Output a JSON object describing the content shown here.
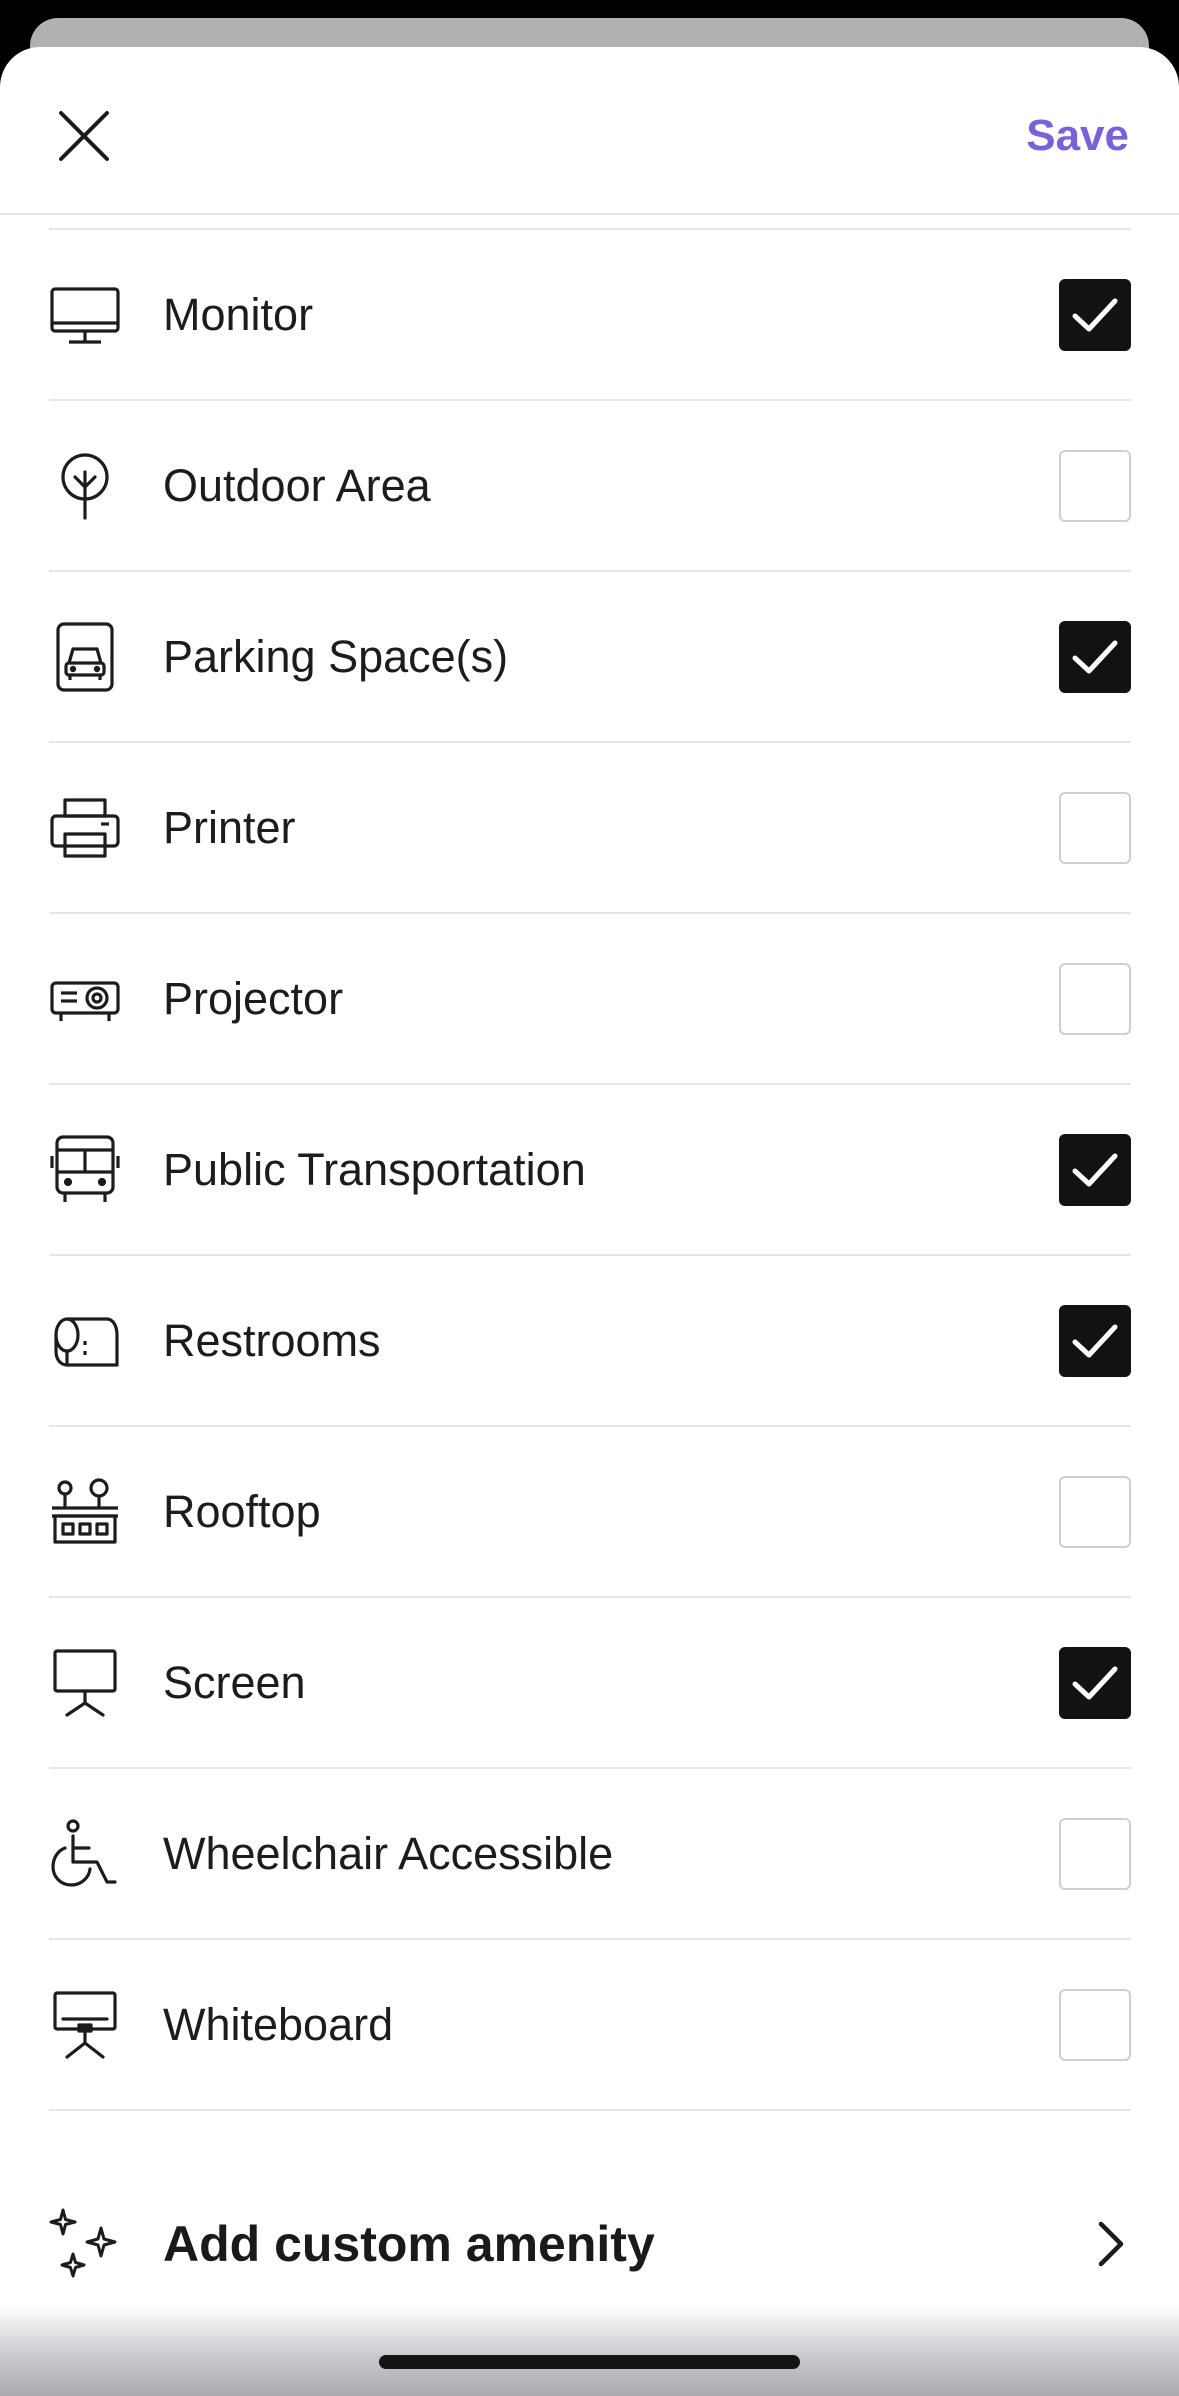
{
  "header": {
    "close_icon": "close-icon",
    "save_label": "Save",
    "accent_color": "#7b61d6"
  },
  "amenities": [
    {
      "label": "Monitor",
      "icon": "monitor-icon",
      "checked": true
    },
    {
      "label": "Outdoor Area",
      "icon": "tree-icon",
      "checked": false
    },
    {
      "label": "Parking Space(s)",
      "icon": "car-icon",
      "checked": true
    },
    {
      "label": "Printer",
      "icon": "printer-icon",
      "checked": false
    },
    {
      "label": "Projector",
      "icon": "projector-icon",
      "checked": false
    },
    {
      "label": "Public Transportation",
      "icon": "bus-icon",
      "checked": true
    },
    {
      "label": "Restrooms",
      "icon": "toilet-paper-icon",
      "checked": true
    },
    {
      "label": "Rooftop",
      "icon": "rooftop-icon",
      "checked": false
    },
    {
      "label": "Screen",
      "icon": "presentation-screen-icon",
      "checked": true
    },
    {
      "label": "Wheelchair Accessible",
      "icon": "wheelchair-icon",
      "checked": false
    },
    {
      "label": "Whiteboard",
      "icon": "whiteboard-icon",
      "checked": false
    }
  ],
  "custom": {
    "label": "Add custom amenity",
    "icon": "sparkles-icon",
    "chevron_icon": "chevron-right-icon"
  }
}
